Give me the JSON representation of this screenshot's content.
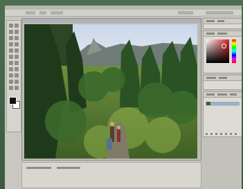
{
  "app": {
    "accent": "#9ab0cf",
    "desktop_color": "#3e5e44"
  },
  "tool_palette": {
    "tools": [
      "move-icon",
      "marquee-icon",
      "lasso-icon",
      "magic-wand-icon",
      "crop-icon",
      "slice-icon",
      "healing-brush-icon",
      "brush-icon",
      "clone-stamp-icon",
      "history-brush-icon",
      "eraser-icon",
      "gradient-icon",
      "blur-icon",
      "dodge-icon",
      "path-select-icon",
      "type-icon",
      "pen-icon",
      "shape-icon",
      "notes-icon",
      "eyedropper-icon",
      "hand-icon",
      "zoom-icon"
    ],
    "foreground_color": "#111111",
    "background_color": "#ffffff"
  },
  "document": {
    "image_subject": "forest-path-photo"
  },
  "color_panel": {
    "selected_color": "#c62a2a"
  },
  "layers_panel": {
    "layer_count": 1
  }
}
